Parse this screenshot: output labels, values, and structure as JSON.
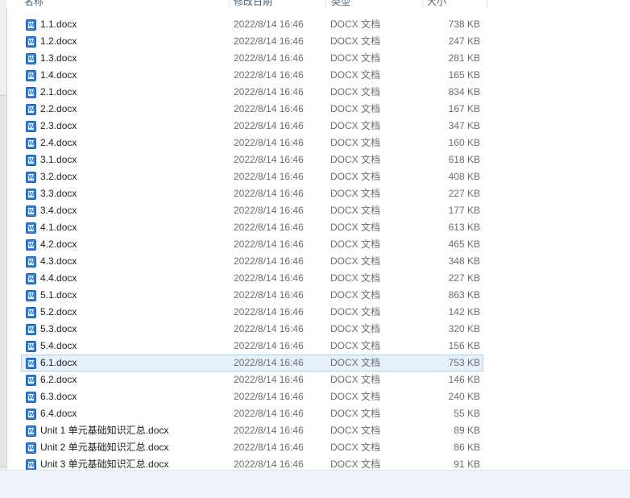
{
  "columns": {
    "name": "名称",
    "date": "修改日期",
    "type": "类型",
    "size": "大小"
  },
  "files": [
    {
      "name": "1.1.docx",
      "date": "2022/8/14 16:46",
      "type": "DOCX 文档",
      "size": "738 KB"
    },
    {
      "name": "1.2.docx",
      "date": "2022/8/14 16:46",
      "type": "DOCX 文档",
      "size": "247 KB"
    },
    {
      "name": "1.3.docx",
      "date": "2022/8/14 16:46",
      "type": "DOCX 文档",
      "size": "281 KB"
    },
    {
      "name": "1.4.docx",
      "date": "2022/8/14 16:46",
      "type": "DOCX 文档",
      "size": "165 KB"
    },
    {
      "name": "2.1.docx",
      "date": "2022/8/14 16:46",
      "type": "DOCX 文档",
      "size": "834 KB"
    },
    {
      "name": "2.2.docx",
      "date": "2022/8/14 16:46",
      "type": "DOCX 文档",
      "size": "167 KB"
    },
    {
      "name": "2.3.docx",
      "date": "2022/8/14 16:46",
      "type": "DOCX 文档",
      "size": "347 KB"
    },
    {
      "name": "2.4.docx",
      "date": "2022/8/14 16:46",
      "type": "DOCX 文档",
      "size": "160 KB"
    },
    {
      "name": "3.1.docx",
      "date": "2022/8/14 16:46",
      "type": "DOCX 文档",
      "size": "618 KB"
    },
    {
      "name": "3.2.docx",
      "date": "2022/8/14 16:46",
      "type": "DOCX 文档",
      "size": "408 KB"
    },
    {
      "name": "3.3.docx",
      "date": "2022/8/14 16:46",
      "type": "DOCX 文档",
      "size": "227 KB"
    },
    {
      "name": "3.4.docx",
      "date": "2022/8/14 16:46",
      "type": "DOCX 文档",
      "size": "177 KB"
    },
    {
      "name": "4.1.docx",
      "date": "2022/8/14 16:46",
      "type": "DOCX 文档",
      "size": "613 KB"
    },
    {
      "name": "4.2.docx",
      "date": "2022/8/14 16:46",
      "type": "DOCX 文档",
      "size": "465 KB"
    },
    {
      "name": "4.3.docx",
      "date": "2022/8/14 16:46",
      "type": "DOCX 文档",
      "size": "348 KB"
    },
    {
      "name": "4.4.docx",
      "date": "2022/8/14 16:46",
      "type": "DOCX 文档",
      "size": "227 KB"
    },
    {
      "name": "5.1.docx",
      "date": "2022/8/14 16:46",
      "type": "DOCX 文档",
      "size": "863 KB"
    },
    {
      "name": "5.2.docx",
      "date": "2022/8/14 16:46",
      "type": "DOCX 文档",
      "size": "142 KB"
    },
    {
      "name": "5.3.docx",
      "date": "2022/8/14 16:46",
      "type": "DOCX 文档",
      "size": "320 KB"
    },
    {
      "name": "5.4.docx",
      "date": "2022/8/14 16:46",
      "type": "DOCX 文档",
      "size": "156 KB"
    },
    {
      "name": "6.1.docx",
      "date": "2022/8/14 16:46",
      "type": "DOCX 文档",
      "size": "753 KB",
      "selected": true
    },
    {
      "name": "6.2.docx",
      "date": "2022/8/14 16:46",
      "type": "DOCX 文档",
      "size": "146 KB"
    },
    {
      "name": "6.3.docx",
      "date": "2022/8/14 16:46",
      "type": "DOCX 文档",
      "size": "240 KB"
    },
    {
      "name": "6.4.docx",
      "date": "2022/8/14 16:46",
      "type": "DOCX 文档",
      "size": "55 KB"
    },
    {
      "name": "Unit 1  单元基础知识汇总.docx",
      "date": "2022/8/14 16:46",
      "type": "DOCX 文档",
      "size": "89 KB"
    },
    {
      "name": "Unit 2  单元基础知识汇总.docx",
      "date": "2022/8/14 16:46",
      "type": "DOCX 文档",
      "size": "86 KB"
    },
    {
      "name": "Unit 3   单元基础知识汇总.docx",
      "date": "2022/8/14 16:46",
      "type": "DOCX 文档",
      "size": "91 KB"
    }
  ],
  "file_icon": "word-document-icon",
  "colors": {
    "selected_bg": "#e6f1fb",
    "selected_border": "#a9d1f2",
    "word_blue": "#2f7fdb"
  }
}
